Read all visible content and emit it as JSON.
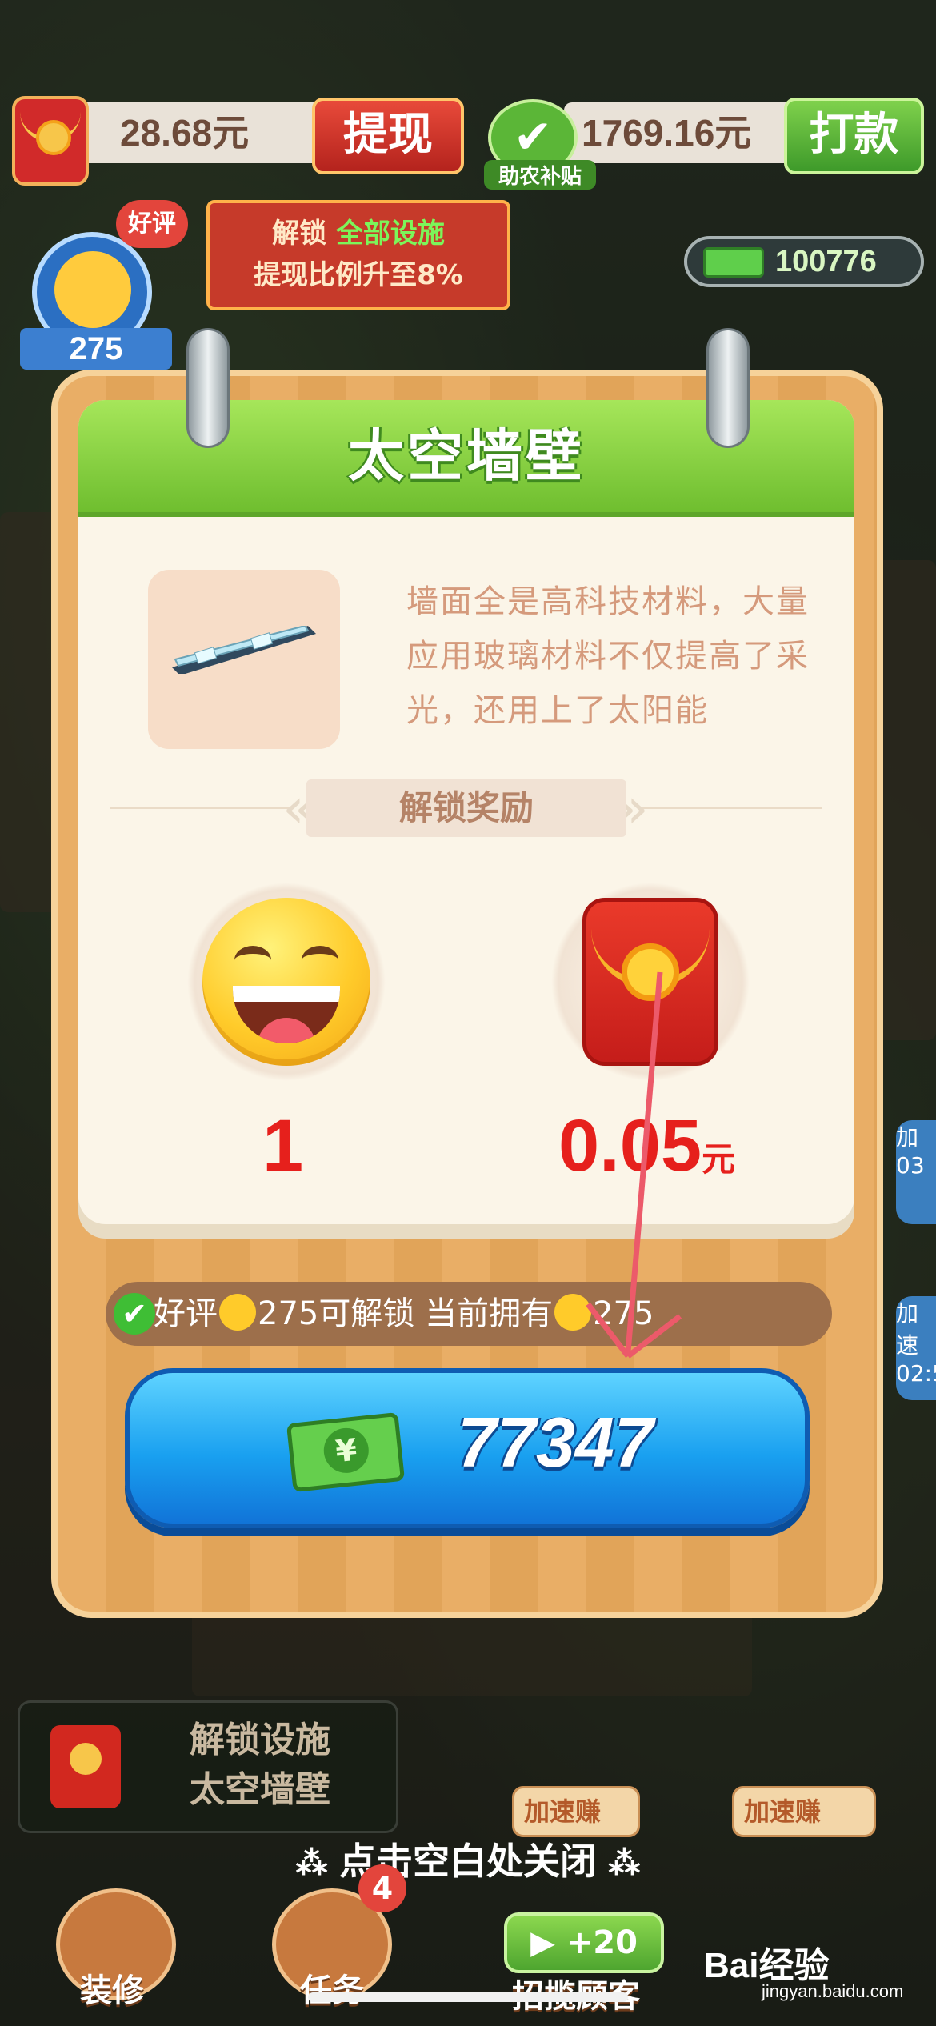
{
  "top_bar": {
    "balance": "28.68元",
    "withdraw_label": "提现",
    "subsidy_amount": "1769.16元",
    "subsidy_label": "助农补贴",
    "pay_label": "打款",
    "tip_line1_prefix": "解锁",
    "tip_line1_highlight": "全部设施",
    "tip_line2": "提现比例升至8%",
    "cash_count": "100776"
  },
  "avatar": {
    "badge": "好评",
    "count": "275"
  },
  "card": {
    "title": "太空墙壁",
    "item_icon": "space-wall-icon",
    "description": "墙面全是高科技材料，大量应用玻璃材料不仅提高了采光，还用上了太阳能",
    "reward_header": "解锁奖励",
    "rewards": [
      {
        "icon": "smile-emoji-icon",
        "value": "1",
        "unit": ""
      },
      {
        "icon": "red-envelope-icon",
        "value": "0.05",
        "unit": "元"
      }
    ],
    "requirement": {
      "prefix": "好评",
      "need": "275",
      "middle": "可解锁 当前拥有",
      "have": "275"
    },
    "price": "77347"
  },
  "bottom": {
    "unlock_line1": "解锁设施",
    "unlock_line2": "太空墙壁",
    "close_hint": "点击空白处关闭",
    "speed_chip_1": "加速赚",
    "speed_chip_2": "加速赚",
    "recruit_label": "+20",
    "nav_decorate": "装修",
    "nav_task": "任务",
    "nav_recruit": "招揽顾客",
    "task_badge": "4",
    "side_label_1": "加",
    "side_label_2": "加速",
    "side_time_1": "03",
    "side_time_2": "02:5"
  },
  "watermark": {
    "brand": "Bai经验",
    "site": "jingyan.baidu.com"
  },
  "colors": {
    "accent_green": "#6fbe2f",
    "price_blue": "#19a0f0",
    "reward_red": "#e6201c",
    "card_wood": "#e8a95c"
  }
}
